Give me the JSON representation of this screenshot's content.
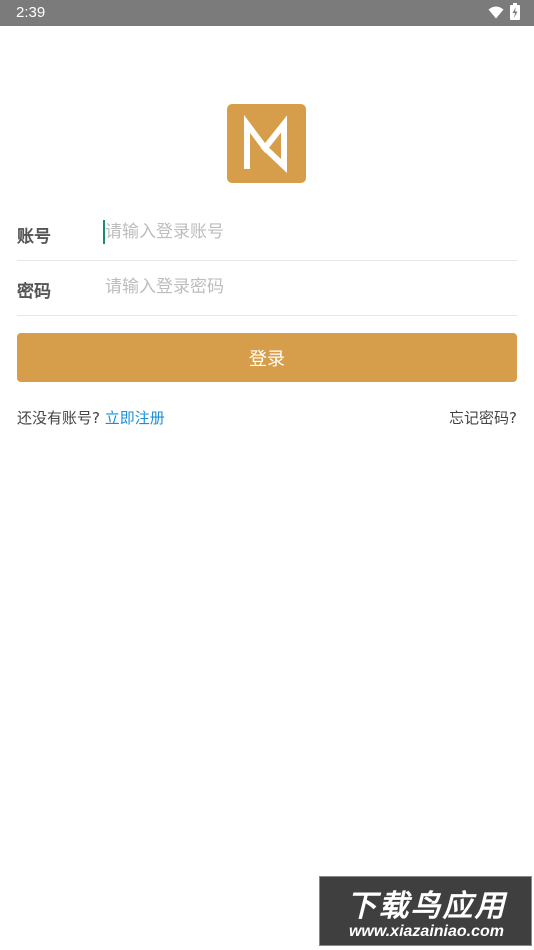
{
  "status_bar": {
    "time": "2:39",
    "icons": [
      "wifi-icon",
      "battery-charging-icon"
    ]
  },
  "logo": {
    "icon": "m-logo-icon",
    "color": "#d69e4a"
  },
  "form": {
    "account": {
      "label": "账号",
      "placeholder": "请输入登录账号",
      "value": ""
    },
    "password": {
      "label": "密码",
      "placeholder": "请输入登录密码",
      "value": ""
    },
    "login_label": "登录"
  },
  "footer_links": {
    "no_account_text": "还没有账号?",
    "register_label": "立即注册",
    "forgot_label": "忘记密码?"
  },
  "watermark": {
    "title": "下载鸟应用",
    "url": "www.xiazainiao.com"
  },
  "colors": {
    "accent": "#d69e4a",
    "link": "#1a8fd6",
    "status_bar": "#7b7b7b"
  }
}
